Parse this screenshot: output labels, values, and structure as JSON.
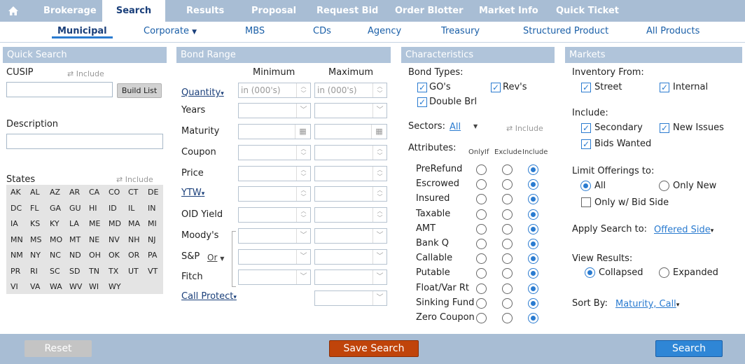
{
  "topnav": {
    "home_icon": "home-icon",
    "tabs": [
      "Brokerage",
      "Search",
      "Results",
      "Proposal",
      "Request Bid",
      "Order Blotter",
      "Market Info",
      "Quick Ticket"
    ],
    "active": "Search"
  },
  "subnav": {
    "tabs": [
      "Municipal",
      "Corporate",
      "MBS",
      "CDs",
      "Agency",
      "Treasury",
      "Structured Product",
      "All Products"
    ],
    "active": "Municipal"
  },
  "quick_search": {
    "title": "Quick Search",
    "cusip_label": "CUSIP",
    "include_label": "Include",
    "build_list": "Build List",
    "description_label": "Description",
    "states_label": "States",
    "states_include": "Include",
    "states": [
      "AK",
      "AL",
      "AZ",
      "AR",
      "CA",
      "CO",
      "CT",
      "DE",
      "DC",
      "FL",
      "GA",
      "GU",
      "HI",
      "ID",
      "IL",
      "IN",
      "IA",
      "KS",
      "KY",
      "LA",
      "ME",
      "MD",
      "MA",
      "MI",
      "MN",
      "MS",
      "MO",
      "MT",
      "NE",
      "NV",
      "NH",
      "NJ",
      "NM",
      "NY",
      "NC",
      "ND",
      "OH",
      "OK",
      "OR",
      "PA",
      "PR",
      "RI",
      "SC",
      "SD",
      "TN",
      "TX",
      "UT",
      "VT",
      "VI",
      "VA",
      "WA",
      "WV",
      "WI",
      "WY"
    ]
  },
  "bond_range": {
    "title": "Bond Range",
    "minimum": "Minimum",
    "maximum": "Maximum",
    "quantity": "Quantity",
    "quantity_placeholder": "in (000's)",
    "years": "Years",
    "maturity": "Maturity",
    "coupon": "Coupon",
    "price": "Price",
    "ytw": "YTW",
    "oid_yield": "OID Yield",
    "moodys": "Moody's",
    "sp": "S&P",
    "or": "Or",
    "fitch": "Fitch",
    "call_protect": "Call Protect"
  },
  "characteristics": {
    "title": "Characteristics",
    "bond_types_label": "Bond Types:",
    "bond_types": {
      "gos": "GO's",
      "revs": "Rev's",
      "double_brl": "Double Brl"
    },
    "sectors_label": "Sectors:",
    "sectors_value": "All",
    "sectors_include": "Include",
    "attributes_label": "Attributes:",
    "col_onlyif": "OnlyIf",
    "col_exclude": "Exclude",
    "col_include": "Include",
    "attributes": [
      "PreRefund",
      "Escrowed",
      "Insured",
      "Taxable",
      "AMT",
      "Bank Q",
      "Callable",
      "Putable",
      "Float/Var Rt",
      "Sinking Fund",
      "Zero Coupon"
    ]
  },
  "markets": {
    "title": "Markets",
    "inventory_label": "Inventory From:",
    "street": "Street",
    "internal": "Internal",
    "include_label": "Include:",
    "secondary": "Secondary",
    "new_issues": "New Issues",
    "bids_wanted": "Bids Wanted",
    "limit_label": "Limit Offerings to:",
    "all": "All",
    "only_new": "Only New",
    "only_bid_side": "Only w/ Bid Side",
    "apply_label": "Apply Search to:",
    "apply_value": "Offered Side",
    "view_label": "View Results:",
    "collapsed": "Collapsed",
    "expanded": "Expanded",
    "sort_label": "Sort By:",
    "sort_value": "Maturity, Call"
  },
  "bottom": {
    "reset": "Reset",
    "save_search": "Save Search",
    "search": "Search"
  },
  "colors": {
    "nav": "#a8bdd4",
    "header": "#b0c4da",
    "accent": "#2a7bd0",
    "save": "#c0440a",
    "search": "#2f86d6"
  }
}
